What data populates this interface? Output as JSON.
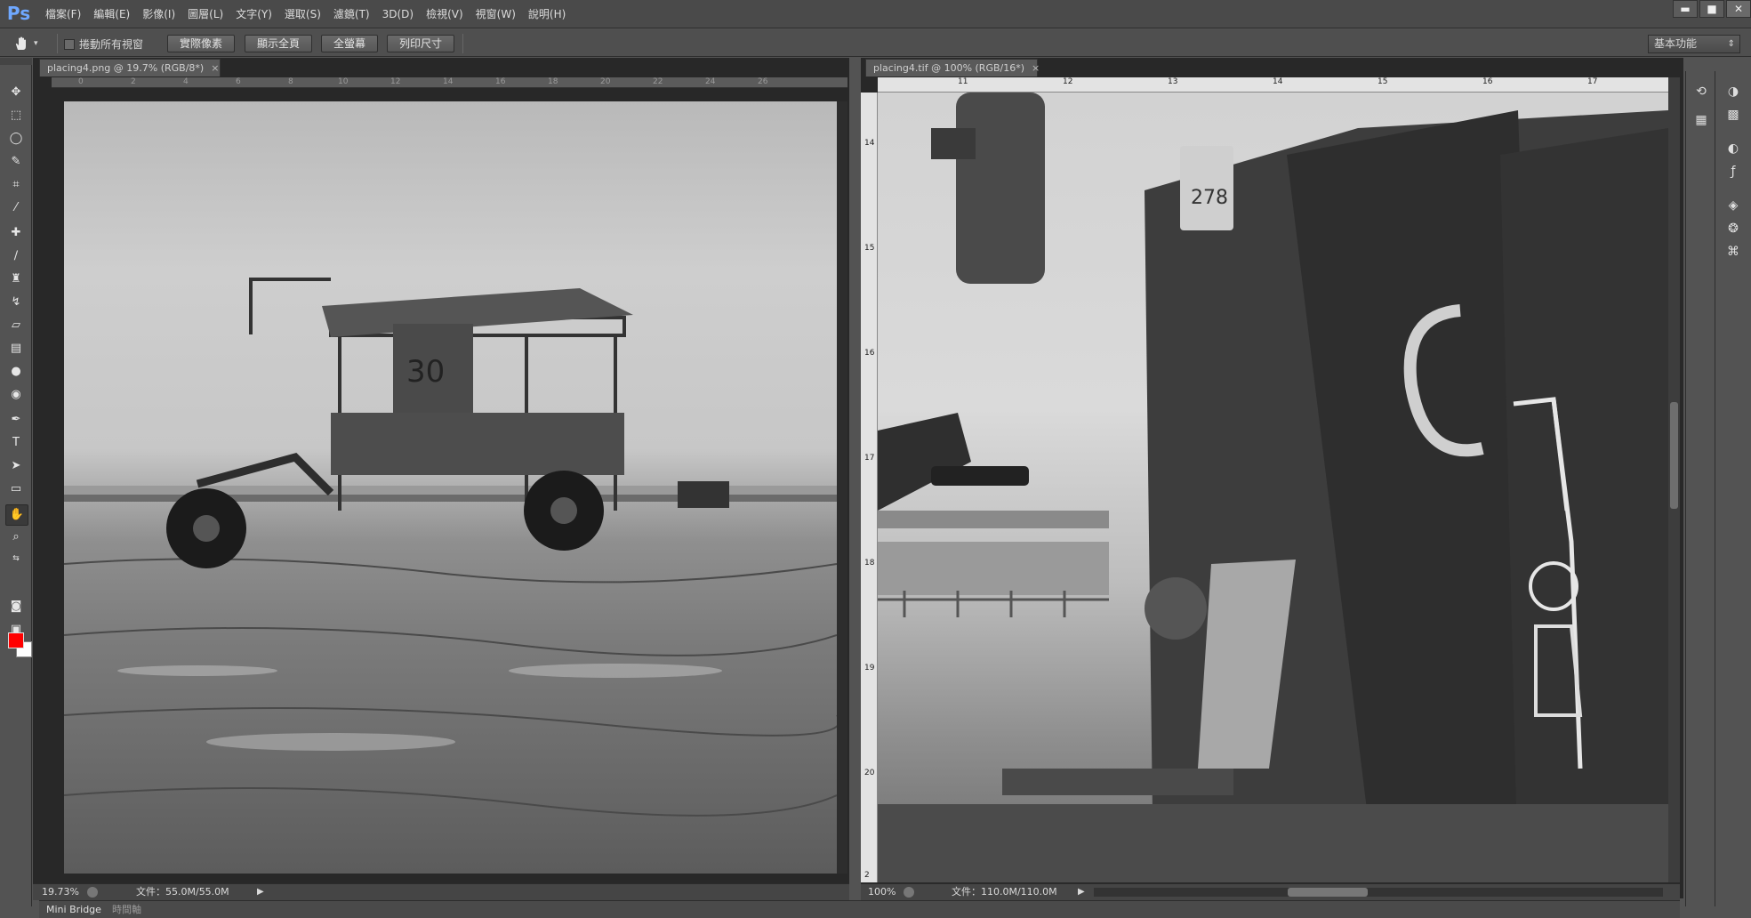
{
  "app": {
    "logo": "Ps"
  },
  "menu": [
    "檔案(F)",
    "編輯(E)",
    "影像(I)",
    "圖層(L)",
    "文字(Y)",
    "選取(S)",
    "濾鏡(T)",
    "3D(D)",
    "檢視(V)",
    "視窗(W)",
    "說明(H)"
  ],
  "window_controls": {
    "minimize": "▬",
    "maximize": "■",
    "close": "✕"
  },
  "options": {
    "scroll_all_label": "捲動所有視窗",
    "buttons": [
      "實際像素",
      "顯示全頁",
      "全螢幕",
      "列印尺寸"
    ],
    "workspace": "基本功能"
  },
  "doc1": {
    "tab_title": "placing4.png @ 19.7% (RGB/8*)",
    "ruler_h": [
      "0",
      "2",
      "4",
      "6",
      "8",
      "10",
      "12",
      "14",
      "16",
      "18",
      "20",
      "22",
      "24",
      "26"
    ],
    "zoom": "19.73%",
    "file_info": "文件：55.0M/55.0M"
  },
  "doc2": {
    "tab_title": "placing4.tif @ 100% (RGB/16*)",
    "ruler_h": [
      "11",
      "12",
      "13",
      "14",
      "15",
      "16",
      "17"
    ],
    "ruler_v": [
      "14",
      "15",
      "16",
      "17",
      "18",
      "19",
      "20",
      "2"
    ],
    "zoom": "100%",
    "file_info": "文件：110.0M/110.0M"
  },
  "bottom_tabs": [
    "Mini Bridge",
    "時間軸"
  ],
  "icons": {
    "tools": [
      "move-icon",
      "marquee-icon",
      "lasso-icon",
      "quick-select-icon",
      "crop-icon",
      "eyedropper-icon",
      "healing-brush-icon",
      "brush-icon",
      "clone-stamp-icon",
      "history-brush-icon",
      "eraser-icon",
      "gradient-icon",
      "blur-icon",
      "dodge-icon",
      "pen-icon",
      "type-icon",
      "path-select-icon",
      "rectangle-icon",
      "hand-icon",
      "zoom-icon"
    ],
    "panels": [
      "history-panel-icon",
      "properties-panel-icon",
      "color-panel-icon",
      "swatches-panel-icon",
      "adjustments-panel-icon",
      "styles-panel-icon",
      "layers-panel-icon",
      "channels-panel-icon",
      "paths-panel-icon"
    ]
  },
  "colors": {
    "foreground": "#ff0000",
    "background": "#ffffff"
  }
}
